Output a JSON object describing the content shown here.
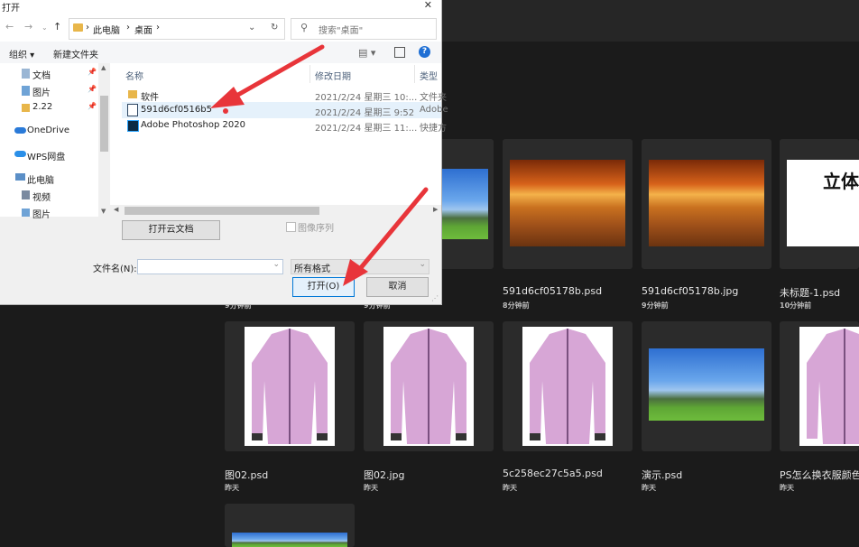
{
  "dialog": {
    "title": "打开",
    "close": "✕",
    "address": {
      "segments": [
        "此电脑",
        "桌面"
      ]
    },
    "search_placeholder": "搜索\"桌面\"",
    "toolbar": {
      "organize": "组织 ▾",
      "new_folder": "新建文件夹"
    },
    "nav_items": [
      "文档",
      "图片",
      "2.22",
      "OneDrive",
      "WPS网盘",
      "此电脑",
      "视频",
      "图片"
    ],
    "columns": {
      "name": "名称",
      "date": "修改日期",
      "type": "类型"
    },
    "files": [
      {
        "name": "软件",
        "date": "2021/2/24 星期三 10:...",
        "type": "文件夹"
      },
      {
        "name": "591d6cf0516b5",
        "date": "2021/2/24 星期三 9:52",
        "type": "Adobe"
      },
      {
        "name": "Adobe Photoshop 2020",
        "date": "2021/2/24 星期三 11:...",
        "type": "快捷方"
      }
    ],
    "open_cloud_doc": "打开云文档",
    "image_sequence": "图像序列",
    "filename_label": "文件名(N):",
    "filename_value": "",
    "filter_value": "所有格式",
    "open_button": "打开(O)",
    "cancel_button": "取消"
  },
  "recent_files": [
    {
      "name": "591d6cf05178b.psd",
      "time": "8分钟前"
    },
    {
      "name": "591d6cf05178b.jpg",
      "time": "9分钟前"
    },
    {
      "name": "未标题-1.psd",
      "time": "10分钟前"
    },
    {
      "name": "图02.psd",
      "time": "昨天"
    },
    {
      "name": "图02.jpg",
      "time": "昨天"
    },
    {
      "name": "5c258ec27c5a5.psd",
      "time": "昨天"
    },
    {
      "name": "演示.psd",
      "time": "昨天"
    },
    {
      "name": "PS怎么换衣服颜色",
      "time": "昨天"
    }
  ],
  "partial_thumb_text": "立体",
  "partial_caption_time_1": "9分钟前",
  "partial_caption_time_2": "9分钟前",
  "colors": {
    "annotation_arrow": "#e8353a",
    "ps_background": "#1b1b1b",
    "dialog_background": "#f0f0f0"
  }
}
